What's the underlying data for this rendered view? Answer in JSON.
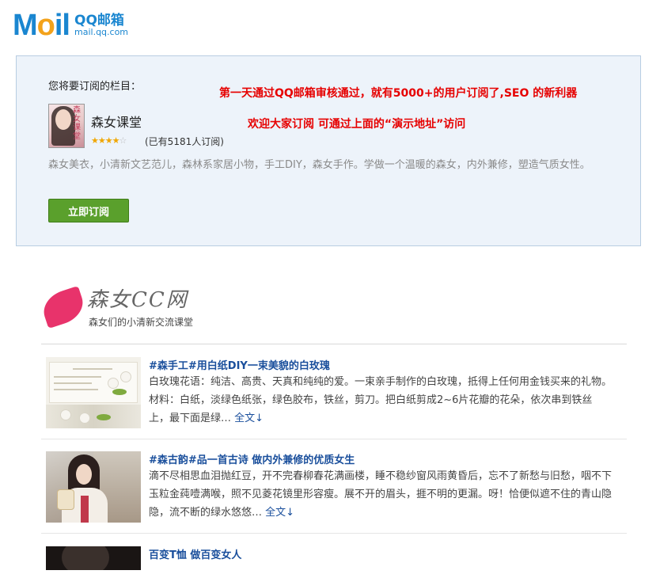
{
  "logo": {
    "brand": "Mail",
    "cn_name": "QQ邮箱",
    "url": "mail.qq.com"
  },
  "subscribe": {
    "prompt": "您将要订阅的栏目：",
    "promo_line1": "第一天通过QQ邮箱审核通过，就有5000+的用户订阅了,SEO 的新利器",
    "promo_line2": "欢迎大家订阅 可通过上面的“演示地址”访问",
    "column_title": "森女课堂",
    "thumb_text": "森女课堂",
    "rating": 4,
    "rating_max": 5,
    "rating_on": "★★★★",
    "rating_off": "☆",
    "subscriber_count": "(已有5181人订阅)",
    "description": "森女美衣，小清新文艺范儿，森林系家居小物，手工DIY，森女手作。学做一个温暖的森女，内外兼修，塑造气质女性。",
    "button_label": "立即订阅"
  },
  "channel": {
    "name": "森女CC网",
    "tagline": "森女们的小清新交流课堂"
  },
  "articles": [
    {
      "title": "#森手工#用白纸DIY一束美貌的白玫瑰",
      "body": "白玫瑰花语：纯洁、高贵、天真和纯纯的爱。一束亲手制作的白玫瑰，抵得上任何用金钱买来的礼物。材料：白纸，淡绿色纸张，绿色胶布，铁丝，剪刀。把白纸剪成2~6片花瓣的花朵，依次串到铁丝上，最下面是绿…",
      "more": "全文↓"
    },
    {
      "title": "#森古韵#品一首古诗 做内外兼修的优质女生",
      "body": "滴不尽相思血泪抛红豆，开不完春柳春花满画楼，睡不稳纱窗风雨黄昏后，忘不了新愁与旧愁，咽不下玉粒金莼噎满喉，照不见菱花镜里形容瘦。展不开的眉头，捱不明的更漏。呀！恰便似遮不住的青山隐隐，流不断的绿水悠悠…",
      "more": "全文↓"
    },
    {
      "title": "百变T恤 做百变女人",
      "body": "",
      "more": ""
    }
  ],
  "colors": {
    "accent_blue": "#1a86d0",
    "promo_red": "#e60000",
    "button_green": "#5aa02c",
    "link_blue": "#1a4f9c",
    "brand_pink": "#e8336b"
  }
}
